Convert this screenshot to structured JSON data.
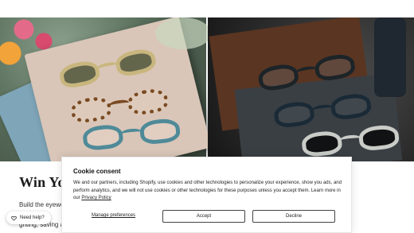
{
  "hero": {
    "left_alt": "Three pairs of glasses on a book with flowers",
    "right_alt": "Three pairs of dark glasses on a slate and wood surface"
  },
  "page": {
    "heading": "Win Your",
    "subtext_1": "Build the eyewea",
    "subtext_2": "ghting, saving a"
  },
  "help": {
    "label": "Need help?",
    "icon": "heart-chat-icon"
  },
  "cookie_banner": {
    "title": "Cookie consent",
    "body_text": "We and our partners, including Shopify, use cookies and other technologies to personalize your experience, show you ads, and perform analytics, and we will not use cookies or other technologies for these purposes unless you accept them. Learn more in our ",
    "policy_link": "Privacy Policy",
    "manage_label": "Manage preferences",
    "accept_label": "Accept",
    "decline_label": "Decline"
  }
}
